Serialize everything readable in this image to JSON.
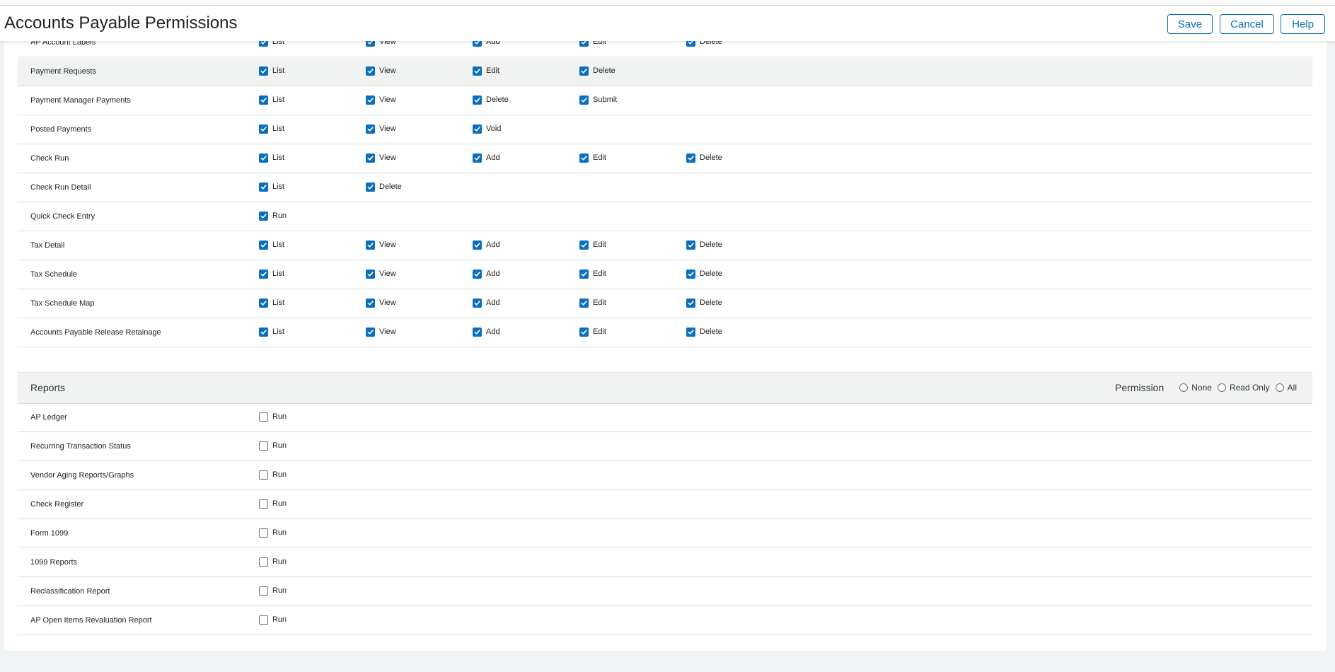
{
  "header": {
    "title": "Accounts Payable Permissions",
    "save_label": "Save",
    "cancel_label": "Cancel",
    "help_label": "Help"
  },
  "colors": {
    "accent": "#0a70b5",
    "checkbox_checked": "#0a6fbf",
    "row_alt": "#f1f3f3",
    "page_bg": "#f1f4f4"
  },
  "activities": [
    {
      "label": "AP Account Labels",
      "perms": [
        {
          "label": "List",
          "checked": true
        },
        {
          "label": "View",
          "checked": true
        },
        {
          "label": "Add",
          "checked": true
        },
        {
          "label": "Edit",
          "checked": true
        },
        {
          "label": "Delete",
          "checked": true
        }
      ]
    },
    {
      "label": "Payment Requests",
      "perms": [
        {
          "label": "List",
          "checked": true
        },
        {
          "label": "View",
          "checked": true
        },
        {
          "label": "Edit",
          "checked": true
        },
        {
          "label": "Delete",
          "checked": true
        }
      ]
    },
    {
      "label": "Payment Manager Payments",
      "perms": [
        {
          "label": "List",
          "checked": true
        },
        {
          "label": "View",
          "checked": true
        },
        {
          "label": "Delete",
          "checked": true
        },
        {
          "label": "Submit",
          "checked": true
        }
      ]
    },
    {
      "label": "Posted Payments",
      "perms": [
        {
          "label": "List",
          "checked": true
        },
        {
          "label": "View",
          "checked": true
        },
        {
          "label": "Void",
          "checked": true
        }
      ]
    },
    {
      "label": "Check Run",
      "perms": [
        {
          "label": "List",
          "checked": true
        },
        {
          "label": "View",
          "checked": true
        },
        {
          "label": "Add",
          "checked": true
        },
        {
          "label": "Edit",
          "checked": true
        },
        {
          "label": "Delete",
          "checked": true
        }
      ]
    },
    {
      "label": "Check Run Detail",
      "perms": [
        {
          "label": "List",
          "checked": true
        },
        {
          "label": "Delete",
          "checked": true
        }
      ]
    },
    {
      "label": "Quick Check Entry",
      "perms": [
        {
          "label": "Run",
          "checked": true
        }
      ]
    },
    {
      "label": "Tax Detail",
      "perms": [
        {
          "label": "List",
          "checked": true
        },
        {
          "label": "View",
          "checked": true
        },
        {
          "label": "Add",
          "checked": true
        },
        {
          "label": "Edit",
          "checked": true
        },
        {
          "label": "Delete",
          "checked": true
        }
      ]
    },
    {
      "label": "Tax Schedule",
      "perms": [
        {
          "label": "List",
          "checked": true
        },
        {
          "label": "View",
          "checked": true
        },
        {
          "label": "Add",
          "checked": true
        },
        {
          "label": "Edit",
          "checked": true
        },
        {
          "label": "Delete",
          "checked": true
        }
      ]
    },
    {
      "label": "Tax Schedule Map",
      "perms": [
        {
          "label": "List",
          "checked": true
        },
        {
          "label": "View",
          "checked": true
        },
        {
          "label": "Add",
          "checked": true
        },
        {
          "label": "Edit",
          "checked": true
        },
        {
          "label": "Delete",
          "checked": true
        }
      ]
    },
    {
      "label": "Accounts Payable Release Retainage",
      "perms": [
        {
          "label": "List",
          "checked": true
        },
        {
          "label": "View",
          "checked": true
        },
        {
          "label": "Add",
          "checked": true
        },
        {
          "label": "Edit",
          "checked": true
        },
        {
          "label": "Delete",
          "checked": true
        }
      ]
    }
  ],
  "reports": {
    "title": "Reports",
    "permission_label": "Permission",
    "options": [
      {
        "label": "None",
        "selected": false
      },
      {
        "label": "Read Only",
        "selected": false
      },
      {
        "label": "All",
        "selected": false
      }
    ],
    "items": [
      {
        "label": "AP Ledger",
        "perms": [
          {
            "label": "Run",
            "checked": false
          }
        ]
      },
      {
        "label": "Recurring Transaction Status",
        "perms": [
          {
            "label": "Run",
            "checked": false
          }
        ]
      },
      {
        "label": "Vendor Aging Reports/Graphs",
        "perms": [
          {
            "label": "Run",
            "checked": false
          }
        ]
      },
      {
        "label": "Check Register",
        "perms": [
          {
            "label": "Run",
            "checked": false
          }
        ]
      },
      {
        "label": "Form 1099",
        "perms": [
          {
            "label": "Run",
            "checked": false
          }
        ]
      },
      {
        "label": "1099 Reports",
        "perms": [
          {
            "label": "Run",
            "checked": false
          }
        ]
      },
      {
        "label": "Reclassification Report",
        "perms": [
          {
            "label": "Run",
            "checked": false
          }
        ]
      },
      {
        "label": "AP Open Items Revaluation Report",
        "perms": [
          {
            "label": "Run",
            "checked": false
          }
        ]
      }
    ]
  }
}
